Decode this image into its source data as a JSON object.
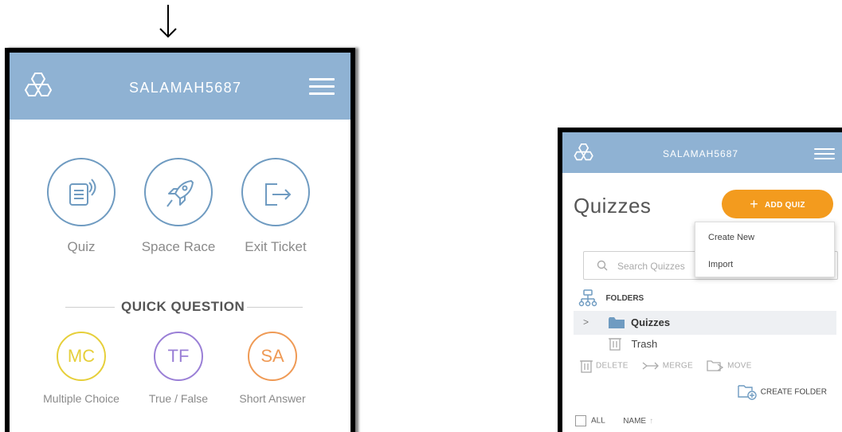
{
  "left_phone": {
    "username": "SALAMAH5687",
    "activities": [
      {
        "label": "Quiz",
        "icon": "quiz-icon"
      },
      {
        "label": "Space Race",
        "icon": "rocket-icon"
      },
      {
        "label": "Exit Ticket",
        "icon": "exit-icon"
      }
    ],
    "quick_question": {
      "title": "QUICK QUESTION",
      "options": [
        {
          "abbr": "MC",
          "label": "Multiple Choice",
          "color": "#e6cf3a"
        },
        {
          "abbr": "TF",
          "label": "True / False",
          "color": "#9a7fd6"
        },
        {
          "abbr": "SA",
          "label": "Short Answer",
          "color": "#ef9a55"
        }
      ]
    }
  },
  "right_phone": {
    "username": "SALAMAH5687",
    "page_title": "Quizzes",
    "add_button": "ADD QUIZ",
    "dropdown": {
      "create_new": "Create New",
      "import": "Import"
    },
    "search_placeholder": "Search Quizzes",
    "folders_label": "FOLDERS",
    "folders": {
      "quizzes": "Quizzes",
      "trash": "Trash"
    },
    "actions": {
      "delete": "DELETE",
      "merge": "MERGE",
      "move": "MOVE"
    },
    "create_folder": "CREATE FOLDER",
    "list_header": {
      "all": "ALL",
      "name": "NAME"
    }
  },
  "colors": {
    "header": "#8fb2d3",
    "accent": "#f39b1e",
    "icon_stroke": "#6f9bc1"
  }
}
